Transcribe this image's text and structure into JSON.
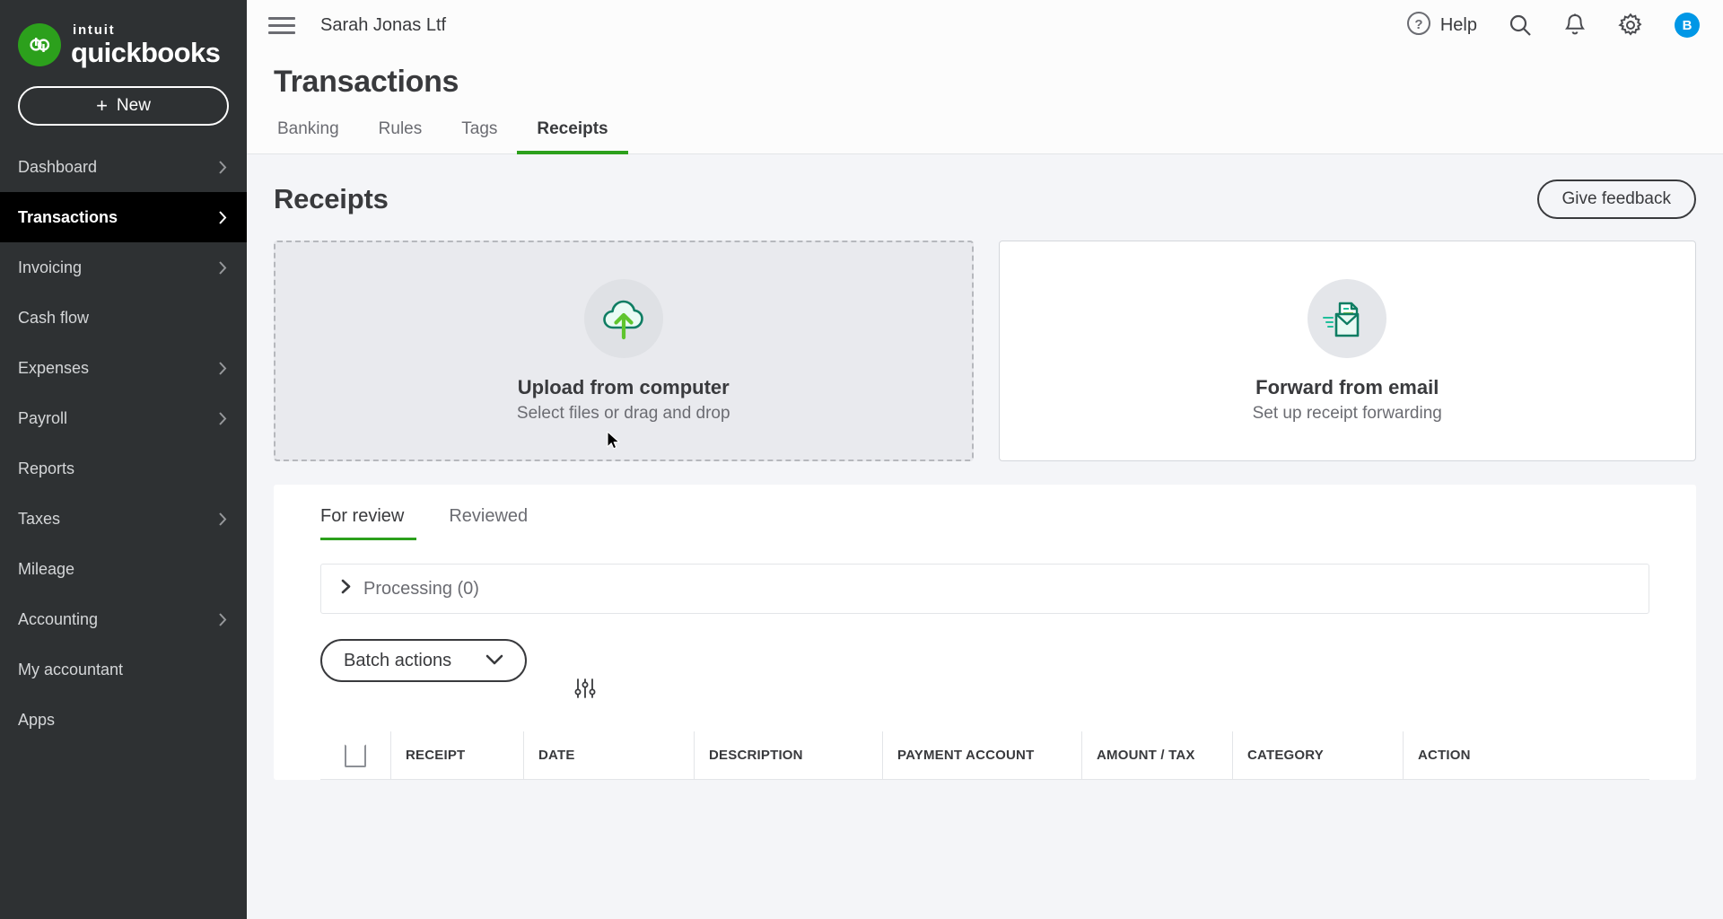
{
  "brand": {
    "intuit": "intuit",
    "product": "quickbooks",
    "mark_letters": "qb",
    "accent_green": "#2ca01c",
    "sidebar_bg": "#2e3133"
  },
  "sidebar": {
    "new_button": "New",
    "new_plus": "+",
    "items": [
      {
        "label": "Dashboard",
        "has_chevron": true,
        "active": false
      },
      {
        "label": "Transactions",
        "has_chevron": true,
        "active": true
      },
      {
        "label": "Invoicing",
        "has_chevron": true,
        "active": false
      },
      {
        "label": "Cash flow",
        "has_chevron": false,
        "active": false
      },
      {
        "label": "Expenses",
        "has_chevron": true,
        "active": false
      },
      {
        "label": "Payroll",
        "has_chevron": true,
        "active": false
      },
      {
        "label": "Reports",
        "has_chevron": false,
        "active": false
      },
      {
        "label": "Taxes",
        "has_chevron": true,
        "active": false
      },
      {
        "label": "Mileage",
        "has_chevron": false,
        "active": false
      },
      {
        "label": "Accounting",
        "has_chevron": true,
        "active": false
      },
      {
        "label": "My accountant",
        "has_chevron": false,
        "active": false
      },
      {
        "label": "Apps",
        "has_chevron": false,
        "active": false
      }
    ]
  },
  "topbar": {
    "menu_icon": "hamburger-icon",
    "company": "Sarah Jonas Ltf",
    "help_label": "Help",
    "help_icon": "question-circle-icon",
    "search_icon": "search-icon",
    "notifications_icon": "bell-icon",
    "settings_icon": "gear-icon",
    "avatar_initial": "B",
    "avatar_color": "#0097e6"
  },
  "page": {
    "title": "Transactions",
    "tabs": [
      {
        "label": "Banking",
        "active": false
      },
      {
        "label": "Rules",
        "active": false
      },
      {
        "label": "Tags",
        "active": false
      },
      {
        "label": "Receipts",
        "active": true
      }
    ]
  },
  "receipts": {
    "heading": "Receipts",
    "feedback_button": "Give feedback",
    "cards": [
      {
        "icon": "cloud-upload-icon",
        "title": "Upload from computer",
        "subtitle": "Select files or drag and drop"
      },
      {
        "icon": "email-receipt-icon",
        "title": "Forward from email",
        "subtitle": "Set up receipt forwarding"
      }
    ],
    "sub_tabs": [
      {
        "label": "For review",
        "active": true
      },
      {
        "label": "Reviewed",
        "active": false
      }
    ],
    "processing": {
      "chevron_icon": "chevron-right-icon",
      "label": "Processing (0)"
    },
    "batch_actions": {
      "label": "Batch actions",
      "chevron_icon": "chevron-down-icon"
    },
    "filter_icon": "sliders-filter-icon",
    "table": {
      "select_all_checkbox": "",
      "columns": [
        "RECEIPT",
        "DATE",
        "DESCRIPTION",
        "PAYMENT ACCOUNT",
        "AMOUNT / TAX",
        "CATEGORY",
        "ACTION"
      ],
      "rows": []
    }
  }
}
